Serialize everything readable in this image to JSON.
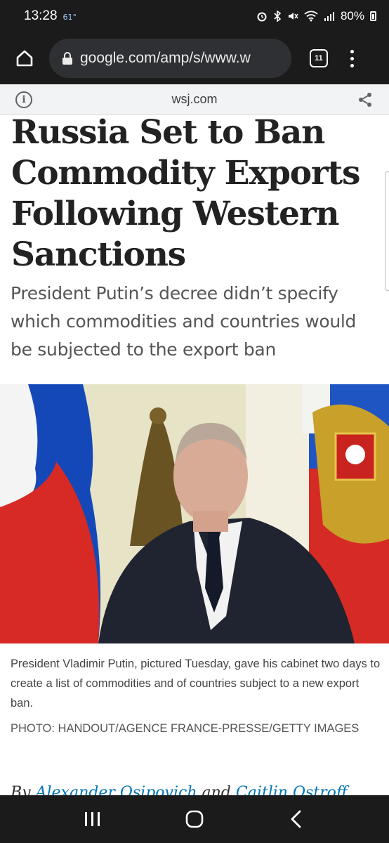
{
  "status": {
    "time": "13:28",
    "temp": "61°",
    "battery": "80%",
    "icons": [
      "alarm-icon",
      "bluetooth-icon",
      "mute-icon",
      "wifi-icon",
      "signal-icon",
      "battery-icon"
    ]
  },
  "browser": {
    "url": "google.com/amp/s/www.w",
    "tab_count": "11",
    "amp_domain": "wsj.com"
  },
  "article": {
    "headline": "Russia Set to Ban Commodity Exports Following Western Sanctions",
    "dek": "President Putin’s decree didn’t specify which commodities and countries would be subjected to the export ban",
    "caption": "President Vladimir Putin, pictured Tuesday, gave his cabinet two days to create a list of commodities and of countries subject to a new export ban.",
    "credit": "PHOTO: HANDOUT/AGENCE FRANCE-PRESSE/GETTY IMAGES",
    "byline_prefix": "By",
    "author1": "Alexander Osipovich",
    "byline_and": "and",
    "author2": "Caitlin Ostroff"
  },
  "colors": {
    "system_bar": "#1b1b1b",
    "url_pill": "#2f3033",
    "amp_bar": "#f1f3f4",
    "link": "#0274b6"
  }
}
